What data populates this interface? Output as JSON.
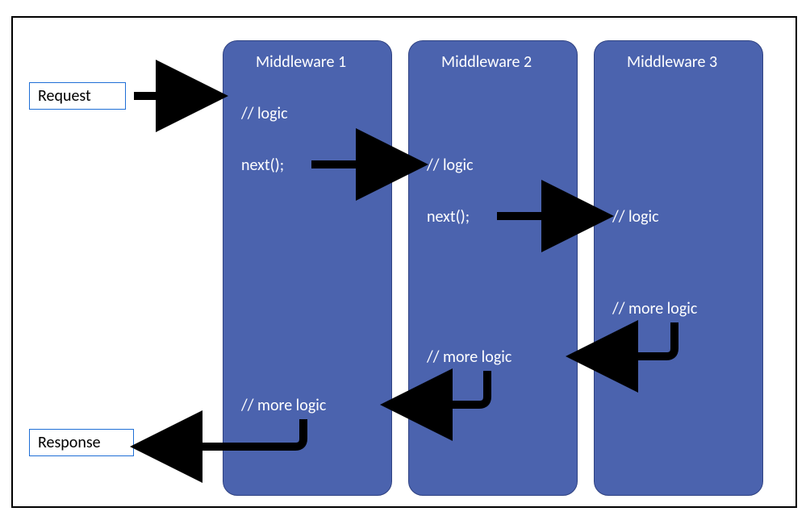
{
  "io": {
    "request": "Request",
    "response": "Response"
  },
  "middleware": [
    {
      "title": "Middleware 1",
      "logic": "// logic",
      "next": "next();",
      "more": "// more logic"
    },
    {
      "title": "Middleware 2",
      "logic": "// logic",
      "next": "next();",
      "more": "// more logic"
    },
    {
      "title": "Middleware 3",
      "logic": "// logic",
      "more": "// more logic"
    }
  ]
}
